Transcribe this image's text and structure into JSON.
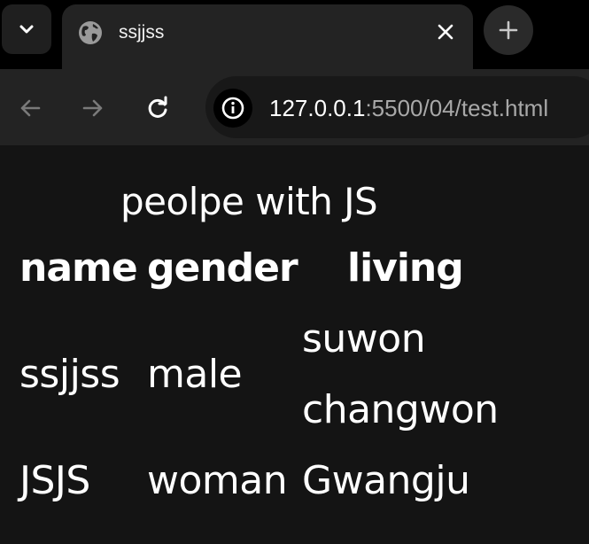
{
  "browser": {
    "tab": {
      "title": "ssjjss"
    },
    "address": {
      "host": "127.0.0.1",
      "rest": ":5500/04/test.html"
    },
    "icons": {
      "tab_search": "chevron-down-icon",
      "favicon": "globe-icon",
      "close": "close-icon",
      "new_tab": "plus-icon",
      "back": "arrow-left-icon",
      "forward": "arrow-right-icon",
      "reload": "reload-icon",
      "site_info": "info-icon"
    }
  },
  "table": {
    "caption": "peolpe with JS",
    "headers": [
      "name",
      "gender",
      "living"
    ],
    "rows": [
      {
        "name": "ssjjss",
        "gender": "male",
        "living": [
          "suwon",
          "changwon"
        ]
      },
      {
        "name": "JSJS",
        "gender": "woman",
        "living": [
          "Gwangju"
        ]
      }
    ]
  }
}
